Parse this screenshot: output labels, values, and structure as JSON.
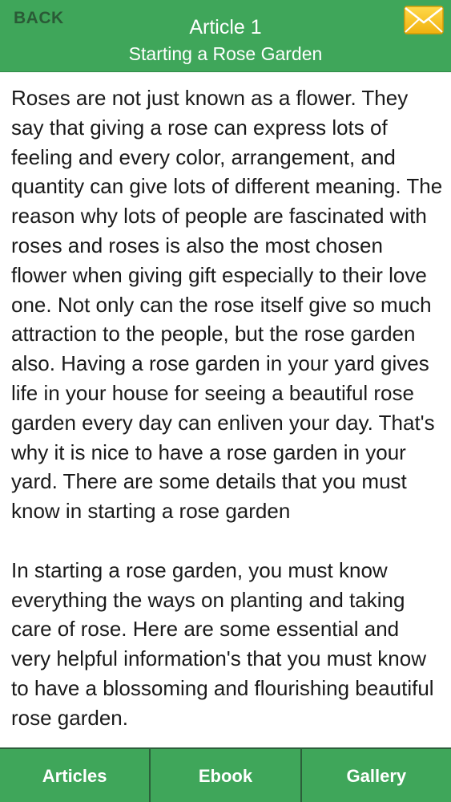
{
  "header": {
    "back_label": "BACK",
    "title": "Article 1",
    "subtitle": "Starting a Rose Garden",
    "mail_icon": "mail-envelope-icon"
  },
  "article": {
    "text": "Roses are not just known as a flower. They say that giving a rose can express lots of feeling and every color, arrangement, and quantity can give lots of different meaning. The reason why lots of people are fascinated with roses and roses is also the most chosen flower when giving gift especially to their love one. Not only can the rose itself give so much attraction to the people, but the rose garden also. Having a rose garden in your yard gives life in your house for seeing a beautiful rose garden every day can enliven your day. That's why it is nice to have a rose garden in your yard. There are some details that you must know in starting a rose garden\n\nIn starting a rose garden, you must know everything the ways on planting and taking care of rose. Here are some essential and very helpful information's that you must know to have a blossoming and flourishing beautiful rose garden."
  },
  "tabs": [
    {
      "label": "Articles"
    },
    {
      "label": "Ebook"
    },
    {
      "label": "Gallery"
    }
  ],
  "colors": {
    "brand_green": "#3fa65a",
    "back_text": "#2a5a36",
    "mail_yellow": "#f5c116"
  }
}
